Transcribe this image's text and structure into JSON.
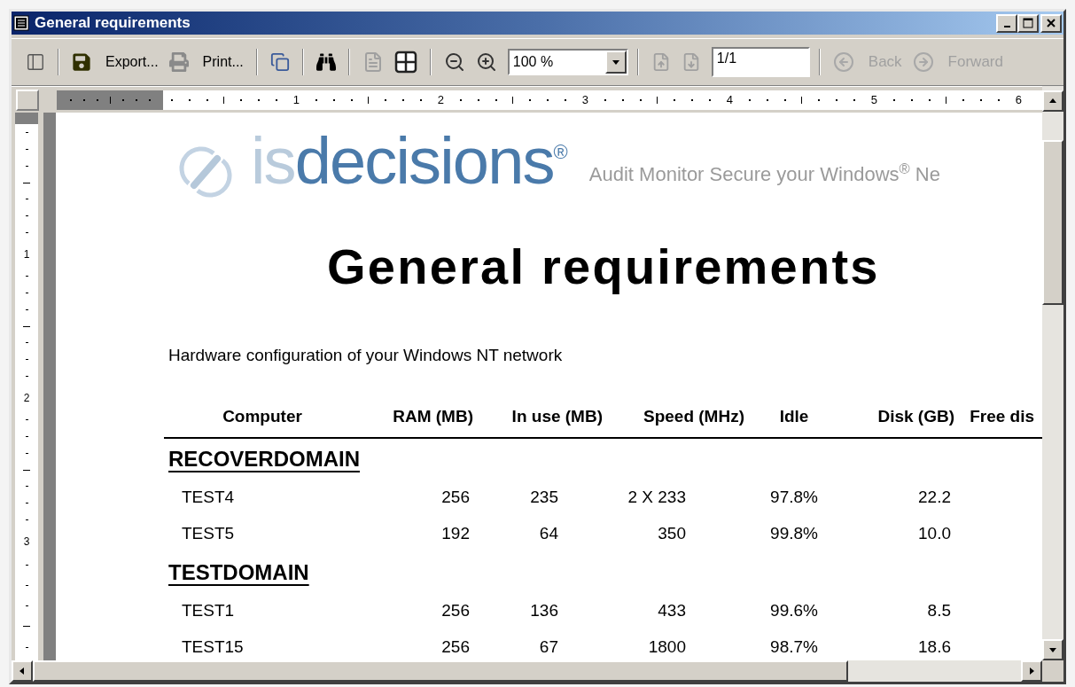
{
  "window": {
    "title": "General requirements"
  },
  "toolbar": [
    {
      "kind": "toggle-panel",
      "disabled": false
    },
    {
      "kind": "separator"
    },
    {
      "kind": "export",
      "label": "Export...",
      "disabled": false
    },
    {
      "kind": "print",
      "label": "Print...",
      "disabled": false
    },
    {
      "kind": "separator"
    },
    {
      "kind": "copy",
      "disabled": false
    },
    {
      "kind": "separator"
    },
    {
      "kind": "find",
      "disabled": false
    },
    {
      "kind": "separator"
    },
    {
      "kind": "single-page",
      "disabled": true
    },
    {
      "kind": "multi-page",
      "disabled": false
    },
    {
      "kind": "separator"
    },
    {
      "kind": "zoom-out",
      "disabled": false
    },
    {
      "kind": "zoom-in",
      "disabled": false
    },
    {
      "kind": "zoom-select",
      "value": "100 %",
      "disabled": false
    },
    {
      "kind": "separator"
    },
    {
      "kind": "prev-page",
      "disabled": true
    },
    {
      "kind": "next-page",
      "disabled": true
    },
    {
      "kind": "page-field",
      "value": "1/1",
      "disabled": false
    },
    {
      "kind": "separator"
    },
    {
      "kind": "back",
      "label": "Back",
      "disabled": true
    },
    {
      "kind": "forward",
      "label": "Forward",
      "disabled": true
    }
  ],
  "ruler": {
    "horizontal": [
      "1",
      "2",
      "3",
      "4",
      "5",
      "6"
    ],
    "vertical": [
      "1",
      "2",
      "3"
    ]
  },
  "report": {
    "logo": {
      "light_part": "is",
      "dark_part": "decisions",
      "mark": "®"
    },
    "tagline": "Audit Monitor Secure your Windows$^{®}$ Ne",
    "title": "General requirements",
    "subtitle": "Hardware configuration of your Windows NT network",
    "table": {
      "columns": [
        "Computer",
        "RAM (MB)",
        "In use (MB)",
        "Speed (MHz)",
        "Idle",
        "Disk (GB)",
        "Free dis"
      ],
      "groups": [
        {
          "name": "RECOVERDOMAIN",
          "rows": [
            [
              "TEST4",
              "256",
              "235",
              "2 X 233",
              "97.8%",
              "22.2"
            ],
            [
              "TEST5",
              "192",
              "64",
              "350",
              "99.8%",
              "10.0"
            ]
          ]
        },
        {
          "name": "TESTDOMAIN",
          "rows": [
            [
              "TEST1",
              "256",
              "136",
              "433",
              "99.6%",
              "8.5"
            ],
            [
              "TEST15",
              "256",
              "67",
              "1800",
              "98.7%",
              "18.6"
            ]
          ]
        }
      ]
    }
  }
}
